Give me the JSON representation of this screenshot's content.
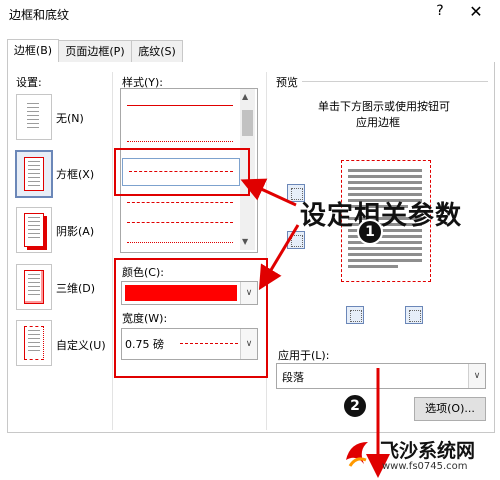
{
  "window": {
    "title": "边框和底纹",
    "help": "?",
    "close": "✕"
  },
  "tabs": [
    {
      "label": "边框(B)",
      "active": true
    },
    {
      "label": "页面边框(P)",
      "active": false
    },
    {
      "label": "底纹(S)",
      "active": false
    }
  ],
  "settings": {
    "header": "设置:",
    "items": [
      {
        "label": "无(N)",
        "icon": "none-icon"
      },
      {
        "label": "方框(X)",
        "icon": "box-icon",
        "selected": true
      },
      {
        "label": "阴影(A)",
        "icon": "shadow-icon"
      },
      {
        "label": "三维(D)",
        "icon": "3d-icon"
      },
      {
        "label": "自定义(U)",
        "icon": "custom-icon"
      }
    ]
  },
  "style": {
    "header": "样式(Y):",
    "color_label": "颜色(C):",
    "color_value": "#ff0000",
    "width_label": "宽度(W):",
    "width_value": "0.75 磅"
  },
  "preview": {
    "header": "预览",
    "hint_line1": "单击下方图示或使用按钮可",
    "hint_line2": "应用边框",
    "apply_label": "应用于(L):",
    "apply_value": "段落",
    "options_button": "选项(O)..."
  },
  "annotation": {
    "text": "设定相关参数",
    "badge1": "1",
    "badge2": "2"
  },
  "watermark": {
    "brand": "飞沙系统网",
    "url": "www.fs0745.com"
  },
  "colors": {
    "accent_red": "#e00000",
    "selection_blue": "#6b87b8"
  }
}
